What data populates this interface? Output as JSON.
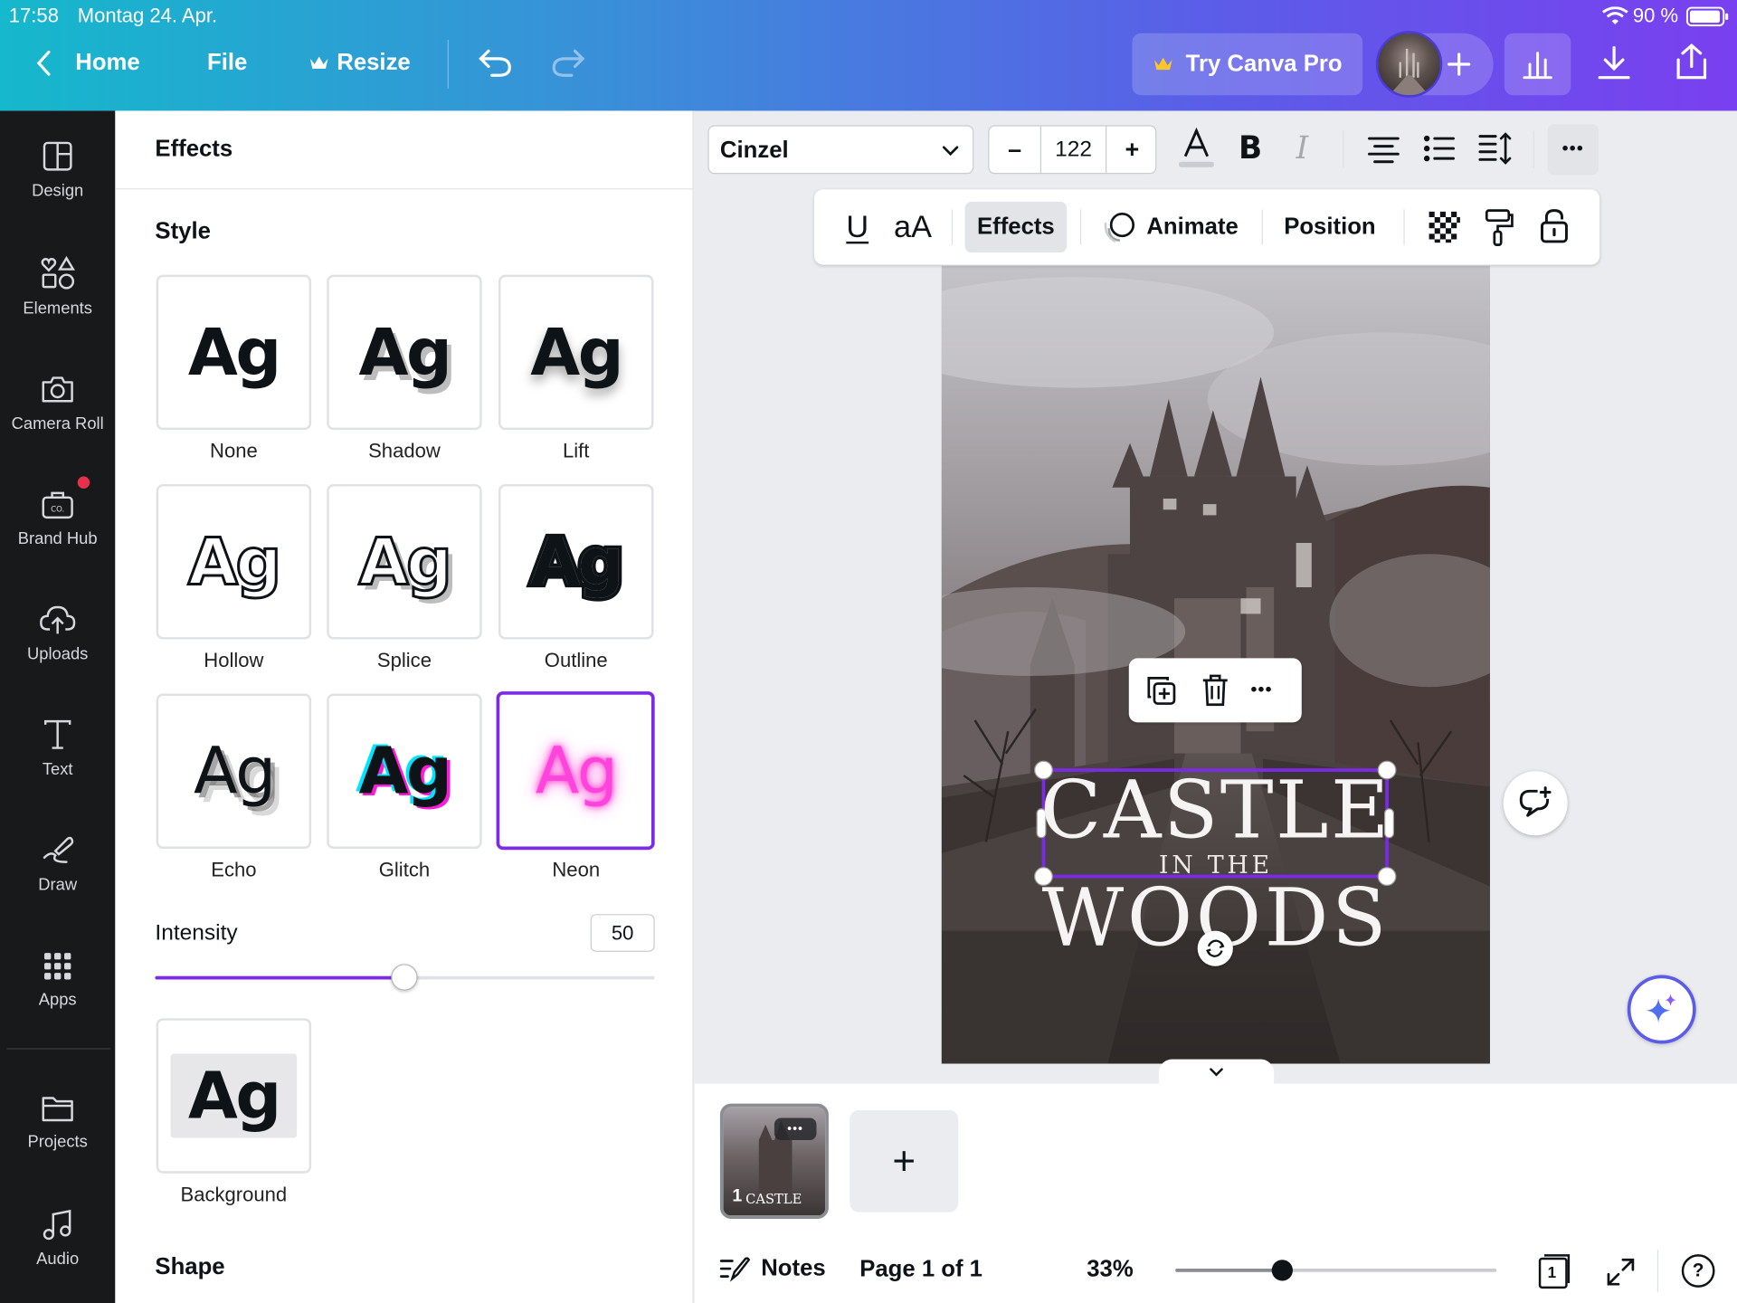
{
  "status_bar": {
    "time": "17:58",
    "date": "Montag 24. Apr.",
    "battery": "90 %"
  },
  "header": {
    "home_label": "Home",
    "file_label": "File",
    "resize_label": "Resize",
    "try_pro_label": "Try Canva Pro"
  },
  "sidebar": {
    "items": [
      {
        "label": "Design",
        "icon": "layout-icon"
      },
      {
        "label": "Elements",
        "icon": "shapes-icon"
      },
      {
        "label": "Camera Roll",
        "icon": "camera-icon"
      },
      {
        "label": "Brand Hub",
        "icon": "brand-icon"
      },
      {
        "label": "Uploads",
        "icon": "cloud-upload-icon"
      },
      {
        "label": "Text",
        "icon": "text-icon"
      },
      {
        "label": "Draw",
        "icon": "draw-icon"
      },
      {
        "label": "Apps",
        "icon": "apps-grid-icon"
      },
      {
        "label": "Projects",
        "icon": "folder-icon"
      },
      {
        "label": "Audio",
        "icon": "music-note-icon"
      }
    ]
  },
  "panel": {
    "title": "Effects",
    "style_heading": "Style",
    "styles": [
      {
        "sample": "Ag",
        "label": "None"
      },
      {
        "sample": "Ag",
        "label": "Shadow"
      },
      {
        "sample": "Ag",
        "label": "Lift"
      },
      {
        "sample": "Ag",
        "label": "Hollow"
      },
      {
        "sample": "Ag",
        "label": "Splice"
      },
      {
        "sample": "Ag",
        "label": "Outline"
      },
      {
        "sample": "Ag",
        "label": "Echo"
      },
      {
        "sample": "Ag",
        "label": "Glitch"
      },
      {
        "sample": "Ag",
        "label": "Neon"
      }
    ],
    "selected_style": "Neon",
    "intensity_label": "Intensity",
    "intensity_value": "50",
    "intensity_fraction": 0.5,
    "background_sample": "Ag",
    "background_label": "Background",
    "shape_heading": "Shape"
  },
  "text_toolbar": {
    "font": "Cinzel",
    "font_size": "122",
    "minus": "–",
    "plus": "+",
    "bold": "B",
    "italic": "I",
    "more": "•••"
  },
  "secondary_toolbar": {
    "underline": "U",
    "case": "aA",
    "effects": "Effects",
    "animate": "Animate",
    "position": "Position"
  },
  "canvas": {
    "title_main": "CASTLE",
    "title_mid": "IN THE",
    "title_bottom": "WOODS",
    "element_more": "•••"
  },
  "bottom_bar": {
    "page_thumb_number": "1",
    "page_thumb_text": "CASTLE",
    "page_thumb_more": "•••",
    "add_page": "+",
    "notes_label": "Notes",
    "page_indicator": "Page 1 of 1",
    "zoom": "33%",
    "zoom_fraction": 0.33,
    "pages_count": "1",
    "help": "?"
  },
  "colors": {
    "accent": "#7d2ae8",
    "neon": "#ff33cc",
    "sidebar_bg": "#18191b",
    "header_gradient_start": "#15b8cc",
    "header_gradient_end": "#7a3ff0"
  }
}
